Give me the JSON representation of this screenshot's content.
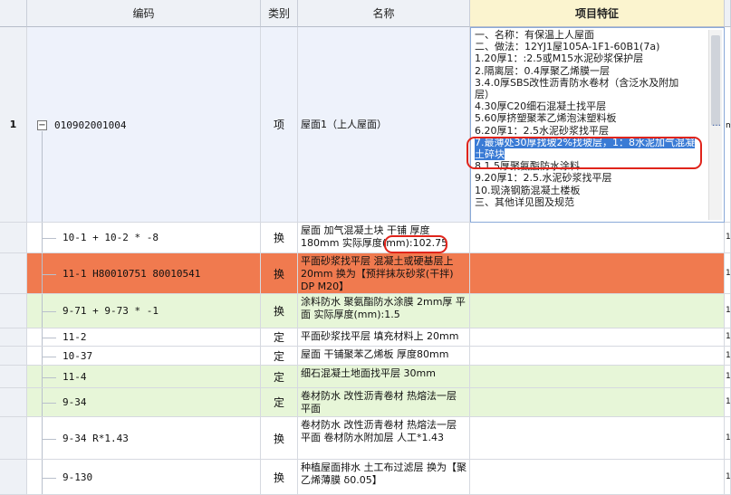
{
  "colors": {
    "header_bg": "#eef1f6",
    "active_header_bg": "#fbf4cf",
    "orange_row": "#f07a4f",
    "green_row": "#e7f6d8",
    "main_row": "#eef2fb",
    "highlight": "#3a7bd5",
    "annotation_red": "#e0241b"
  },
  "headers": {
    "code": "编码",
    "category": "类别",
    "name": "名称",
    "feature": "项目特征"
  },
  "main_item": {
    "row_num": "1",
    "toggle": "−",
    "code": "010902001004",
    "category": "项",
    "name": "屋面1（上人屋面）",
    "more": "…",
    "edge": "m",
    "features": [
      "一、名称：有保温上人屋面",
      "二、做法：12YJ1屋105A-1F1-60B1(7a)",
      "1.20厚1：:2.5或M15水泥砂浆保护层",
      "2.隔离层：0.4厚聚乙烯膜一层",
      "3.4.0厚SBS改性沥青防水卷材（含泛水及附加",
      "层）",
      "4.30厚C20细石混凝土找平层",
      "5.60厚挤塑聚苯乙烯泡沫塑料板",
      "6.20厚1：2.5水泥砂浆找平层",
      "7.最薄处30厚找坡2%找坡层，1：8水泥加气混凝",
      "土碎块",
      "8.1.5厚聚氨酯防水涂料",
      "9.20厚1：2.5.水泥砂浆找平层",
      "10.现浇钢筋混凝土楼板",
      "三、其他详见图及规范"
    ]
  },
  "sub_rows": [
    {
      "code": "10-1 + 10-2 * -8",
      "category": "换",
      "name": "屋面 加气混凝土块 干铺 厚度180mm  实际厚度(mm):102.75",
      "style": "white",
      "edge": "1"
    },
    {
      "code": "11-1 H80010751 80010541",
      "category": "换",
      "name": "平面砂浆找平层 混凝土或硬基层上 20mm  换为【预拌抹灰砂浆(干拌) DP M20】",
      "style": "orange",
      "edge": "1"
    },
    {
      "code": "9-71 + 9-73 * -1",
      "category": "换",
      "name": "涂料防水 聚氨酯防水涂膜 2mm厚 平面  实际厚度(mm):1.5",
      "style": "green",
      "edge": "1"
    },
    {
      "code": "11-2",
      "category": "定",
      "name": "平面砂浆找平层 填充材料上 20mm",
      "style": "white",
      "edge": "1"
    },
    {
      "code": "10-37",
      "category": "定",
      "name": "屋面 干铺聚苯乙烯板 厚度80mm",
      "style": "white",
      "edge": "1"
    },
    {
      "code": "11-4",
      "category": "定",
      "name": "细石混凝土地面找平层 30mm",
      "style": "green",
      "edge": "1"
    },
    {
      "code": "9-34",
      "category": "定",
      "name": "卷材防水 改性沥青卷材 热熔法一层 平面",
      "style": "green",
      "edge": "1"
    },
    {
      "code": "9-34 R*1.43",
      "category": "换",
      "name": "卷材防水 改性沥青卷材 热熔法一层 平面  卷材防水附加层 人工*1.43",
      "style": "white",
      "edge": "1"
    },
    {
      "code": "9-130",
      "category": "换",
      "name": "种植屋面排水 土工布过滤层  换为【聚乙烯薄膜 δ0.05】",
      "style": "white",
      "edge": "1"
    }
  ]
}
